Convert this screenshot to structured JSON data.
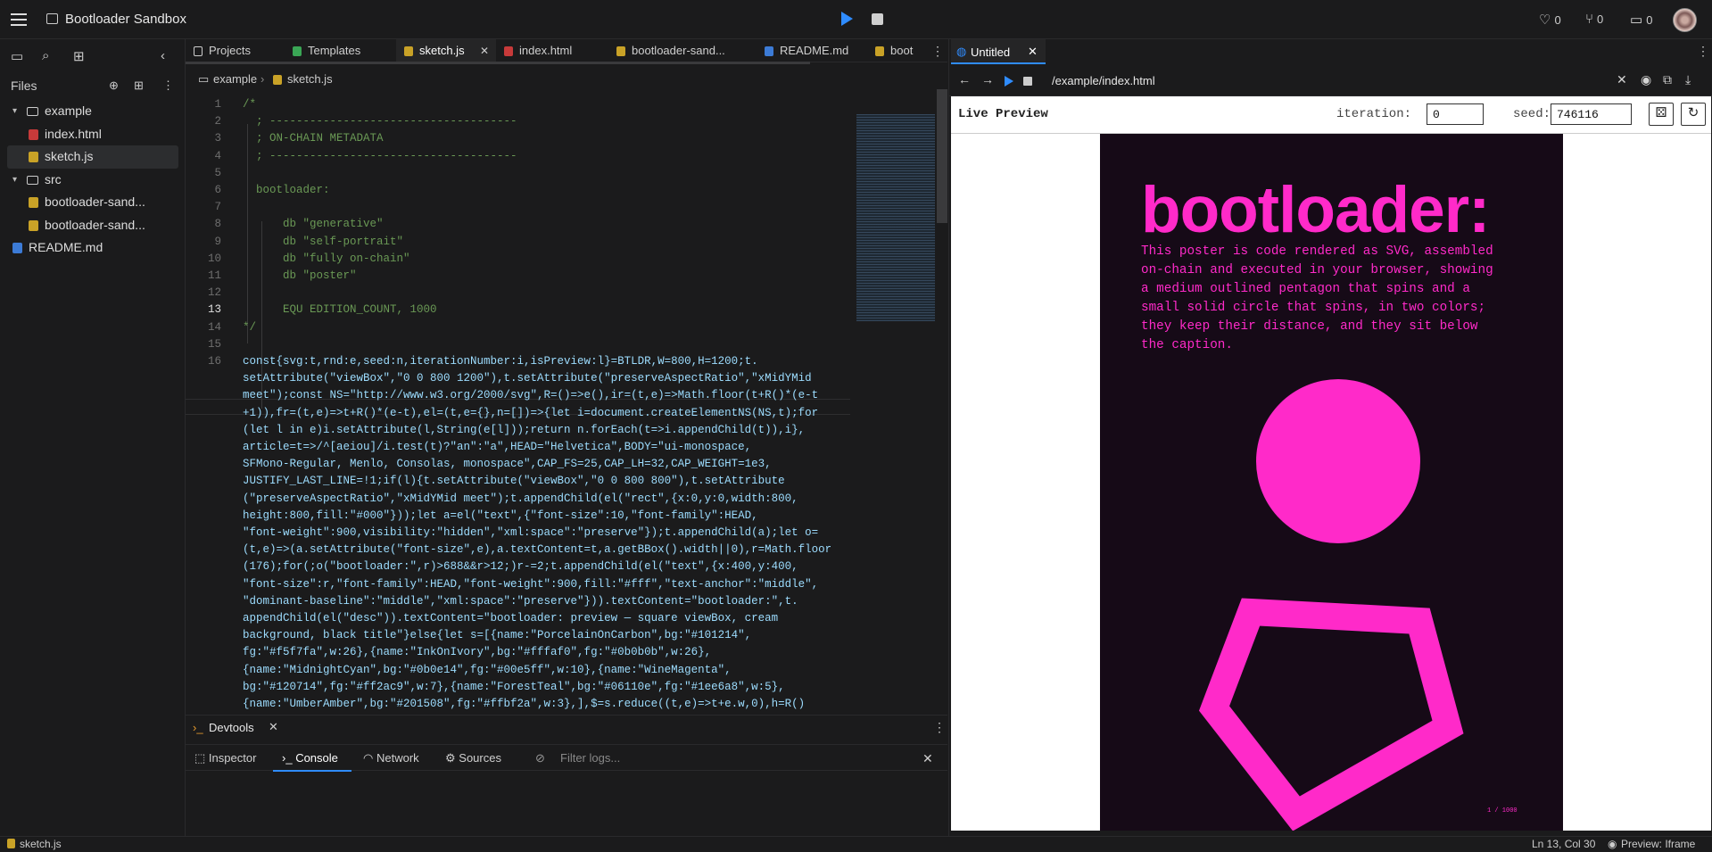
{
  "app": {
    "title": "Bootloader Sandbox",
    "stats": {
      "likes": "0",
      "forks": "0",
      "comments": "0"
    }
  },
  "sidebar": {
    "header": "Files",
    "tree": [
      {
        "label": "example",
        "type": "folder"
      },
      {
        "label": "index.html",
        "type": "html"
      },
      {
        "label": "sketch.js",
        "type": "js"
      },
      {
        "label": "src",
        "type": "folder"
      },
      {
        "label": "bootloader-sand...",
        "type": "js"
      },
      {
        "label": "bootloader-sand...",
        "type": "js"
      },
      {
        "label": "README.md",
        "type": "md"
      }
    ]
  },
  "editor": {
    "tabs": [
      "Projects",
      "Templates",
      "sketch.js",
      "index.html",
      "bootloader-sand...",
      "README.md",
      "boot"
    ],
    "breadcrumb": {
      "folder": "example",
      "file": "sketch.js"
    },
    "line_numbers": [
      "1",
      "2",
      "3",
      "4",
      "5",
      "6",
      "7",
      "8",
      "9",
      "10",
      "11",
      "12",
      "13",
      "14",
      "15",
      "16"
    ],
    "comment_lines": [
      "/*",
      "  ; -------------------------------------",
      "  ; ON-CHAIN METADATA",
      "  ; -------------------------------------",
      "",
      "  bootloader:",
      "",
      "      db \"generative\"",
      "      db \"self-portrait\"",
      "      db \"fully on-chain\"",
      "      db \"poster\"",
      "",
      "      EQU EDITION_COUNT, 1000",
      "*/",
      ""
    ],
    "js_lines": [
      "const{svg:t,rnd:e,seed:n,iterationNumber:i,isPreview:l}=BTLDR,W=800,H=1200;t.",
      "setAttribute(\"viewBox\",\"0 0 800 1200\"),t.setAttribute(\"preserveAspectRatio\",\"xMidYMid",
      "meet\");const NS=\"http://www.w3.org/2000/svg\",R=()=>e(),ir=(t,e)=>Math.floor(t+R()*(e-t",
      "+1)),fr=(t,e)=>t+R()*(e-t),el=(t,e={},n=[])=>{let i=document.createElementNS(NS,t);for",
      "(let l in e)i.setAttribute(l,String(e[l]));return n.forEach(t=>i.appendChild(t)),i},",
      "article=t=>/^[aeiou]/i.test(t)?\"an\":\"a\",HEAD=\"Helvetica\",BODY=\"ui-monospace,",
      "SFMono-Regular, Menlo, Consolas, monospace\",CAP_FS=25,CAP_LH=32,CAP_WEIGHT=1e3,",
      "JUSTIFY_LAST_LINE=!1;if(l){t.setAttribute(\"viewBox\",\"0 0 800 800\"),t.setAttribute",
      "(\"preserveAspectRatio\",\"xMidYMid meet\");t.appendChild(el(\"rect\",{x:0,y:0,width:800,",
      "height:800,fill:\"#000\"}));let a=el(\"text\",{\"font-size\":10,\"font-family\":HEAD,",
      "\"font-weight\":900,visibility:\"hidden\",\"xml:space\":\"preserve\"});t.appendChild(a);let o=",
      "(t,e)=>(a.setAttribute(\"font-size\",e),a.textContent=t,a.getBBox().width||0),r=Math.floor",
      "(176);for(;o(\"bootloader:\",r)>688&&r>12;)r-=2;t.appendChild(el(\"text\",{x:400,y:400,",
      "\"font-size\":r,\"font-family\":HEAD,\"font-weight\":900,fill:\"#fff\",\"text-anchor\":\"middle\",",
      "\"dominant-baseline\":\"middle\",\"xml:space\":\"preserve\"})).textContent=\"bootloader:\",t.",
      "appendChild(el(\"desc\")).textContent=\"bootloader: preview — square viewBox, cream",
      "background, black title\"}else{let s=[{name:\"PorcelainOnCarbon\",bg:\"#101214\",",
      "fg:\"#f5f7fa\",w:26},{name:\"InkOnIvory\",bg:\"#fffaf0\",fg:\"#0b0b0b\",w:26},",
      "{name:\"MidnightCyan\",bg:\"#0b0e14\",fg:\"#00e5ff\",w:10},{name:\"WineMagenta\",",
      "bg:\"#120714\",fg:\"#ff2ac9\",w:7},{name:\"ForestTeal\",bg:\"#06110e\",fg:\"#1ee6a8\",w:5},",
      "{name:\"UmberAmber\",bg:\"#201508\",fg:\"#ffbf2a\",w:3},],$=s.reduce((t,e)=>t+e.w,0),h=R()"
    ]
  },
  "devtools": {
    "title": "Devtools",
    "tabs": [
      "Inspector",
      "Console",
      "Network",
      "Sources"
    ],
    "filter_placeholder": "Filter logs..."
  },
  "preview": {
    "tab_label": "Untitled",
    "url": "/example/index.html",
    "live_label": "Live Preview",
    "iteration_label": "iteration:",
    "iteration_value": "0",
    "seed_label": "seed:",
    "seed_value": "746116",
    "poster": {
      "title": "bootloader:",
      "caption": "This poster is code rendered as SVG, assembled on-chain and executed in your browser, showing a medium outlined pentagon that spins and a small solid circle that spins, in two colors; they keep their distance, and they sit below the caption.",
      "page": "1 / 1000",
      "bg": "#160a17",
      "fg": "#ff2ac9"
    }
  },
  "status": {
    "file": "sketch.js",
    "position": "Ln 13, Col 30",
    "preview_mode": "Preview: Iframe"
  },
  "colors": {
    "accent": "#2f8cff",
    "poster_magenta": "#ff2ac9"
  }
}
